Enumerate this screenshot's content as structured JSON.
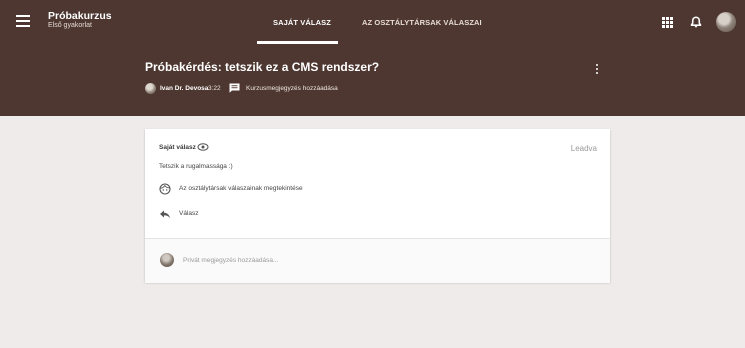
{
  "topbar": {
    "course_title": "Próbakurzus",
    "course_subtitle": "Első gyakorlat",
    "tabs": [
      {
        "label": "SAJÁT VÁLASZ",
        "active": true
      },
      {
        "label": "AZ OSZTÁLYTÁRSAK VÁLASZAI",
        "active": false
      }
    ],
    "icons": [
      "menu-icon",
      "apps-icon",
      "bell-icon",
      "user-avatar"
    ]
  },
  "question": {
    "title": "Próbakérdés: tetszik ez a CMS rendszer?",
    "author": "Ivan Dr. Devosa",
    "time": "3:22",
    "comment_link": "Kurzusmegjegyzés hozzáadása"
  },
  "card": {
    "label": "Saját válasz",
    "status": "Leadva",
    "answer_text": "Tetszik a rugalmassága :)",
    "view_peers_label": "Az osztálytársak válaszainak megtekintése",
    "reply_label": "Válasz",
    "private_comment_placeholder": "Privát megjegyzés hozzáadása..."
  },
  "colors": {
    "header": "#4d3730",
    "page_background": "#eeebea",
    "card": "#ffffff",
    "status_text": "#9a9a9a"
  }
}
